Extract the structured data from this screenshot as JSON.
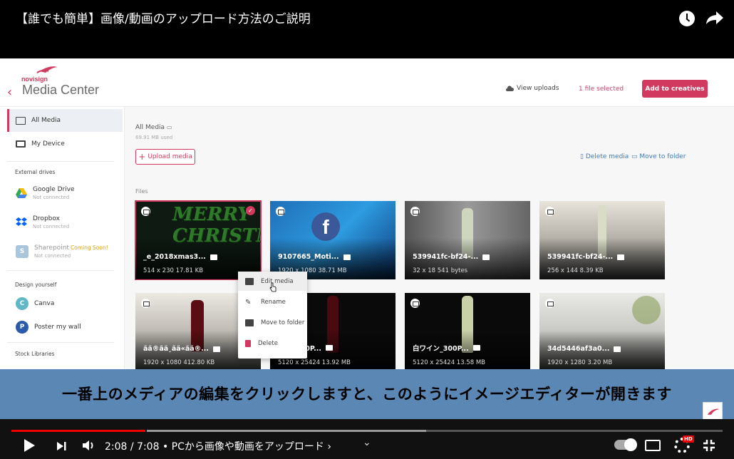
{
  "player": {
    "video_title": "【誰でも簡単】画像/動画のアップロード方法のご説明",
    "subtitle": "一番上のメディアの編集をクリックしますと、このようにイメージエディターが開きます",
    "time": "2:08 / 7:08",
    "chapter": "• PCから画像や動画をアップロード ›",
    "hd_badge": "HD",
    "progress_fraction": 0.29
  },
  "app": {
    "logo": "novisign",
    "title": "Media Center",
    "view_uploads": "View uploads",
    "selected": "1 file selected",
    "add_button": "Add to creatives"
  },
  "sidebar": {
    "all_media": "All Media",
    "my_device": "My Device",
    "external_drives": "External drives",
    "google_drive": "Google Drive",
    "dropbox": "Dropbox",
    "sharepoint": "Sharepoint",
    "coming_soon": "Coming Soon!",
    "not_connected": "Not connected",
    "design_yourself": "Design yourself",
    "canva": "Canva",
    "poster": "Poster my wall",
    "stock_libraries": "Stock Libraries"
  },
  "main": {
    "breadcrumb": "All Media",
    "used": "69.91 MB used",
    "upload": "Upload media",
    "delete_media": "Delete media",
    "move_folder": "Move to folder",
    "files_label": "Files",
    "files": [
      {
        "name": "_e_2018xmas3...",
        "meta": "514 x 230   17.81 KB"
      },
      {
        "name": "9107665_Moti...",
        "meta": "1920 x 1080   38.71 MB"
      },
      {
        "name": "539941fc-bf24-...",
        "meta": "32 x 18   541 bytes"
      },
      {
        "name": "539941fc-bf24-...",
        "meta": "256 x 144   8.39 KB"
      },
      {
        "name": "ãä®ãä¸ãä«ãä®...",
        "meta": "1920 x 1080   412.80 KB"
      },
      {
        "name": "...ン_300P...",
        "meta": "5120 x 25424   13.92 MB"
      },
      {
        "name": "白ワイン_300P...",
        "meta": "5120 x 25424   13.58 MB"
      },
      {
        "name": "34d5446af3a0...",
        "meta": "1920 x 1280   3.20 MB"
      }
    ]
  },
  "context_menu": {
    "edit": "Edit media",
    "rename": "Rename",
    "move": "Move to folder",
    "delete": "Delete"
  },
  "colors": {
    "accent": "#d13a5e",
    "link": "#3b7bbf",
    "subtitle_band": "#5b87b5"
  }
}
